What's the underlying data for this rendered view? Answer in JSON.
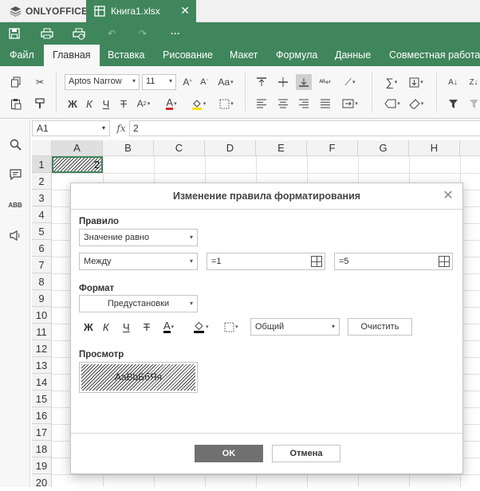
{
  "app": {
    "brand": "ONLYOFFICE",
    "doc_tab_title": "Книга1.xlsx"
  },
  "menu": {
    "tabs": [
      "Файл",
      "Главная",
      "Вставка",
      "Рисование",
      "Макет",
      "Формула",
      "Данные",
      "Совместная работа"
    ],
    "active": "Главная"
  },
  "ribbon": {
    "font_name": "Aptos Narrow",
    "font_size": "11"
  },
  "formula_bar": {
    "cell_ref": "A1",
    "fx_label": "fx",
    "formula": "2"
  },
  "grid": {
    "columns": [
      "A",
      "B",
      "C",
      "D",
      "E",
      "F",
      "G",
      "H"
    ],
    "rows": [
      "1",
      "2",
      "3",
      "4",
      "5",
      "6",
      "7",
      "8",
      "9",
      "10",
      "11",
      "12",
      "13",
      "14",
      "15",
      "16",
      "17",
      "18",
      "19",
      "20"
    ],
    "cells": {
      "A1": "2"
    }
  },
  "dialog": {
    "title": "Изменение правила форматирования",
    "rule_label": "Правило",
    "rule_type": "Значение равно",
    "operator": "Между",
    "value1": "=1",
    "value2": "=5",
    "format_label": "Формат",
    "preset": "Предустановки",
    "bold_glyph": "Ж",
    "italic_glyph": "К",
    "underline_glyph": "Ч",
    "strike_glyph": "Т",
    "font_color_glyph": "А",
    "number_format": "Общий",
    "clear_label": "Очистить",
    "preview_label": "Просмотр",
    "preview_text": "AaBbБбЯя",
    "ok_label": "OK",
    "cancel_label": "Отмена"
  },
  "colors": {
    "brand_green": "#40865c",
    "ok_button": "#707070",
    "font_red": "#d9262c",
    "highlight_yellow": "#f5e100"
  }
}
